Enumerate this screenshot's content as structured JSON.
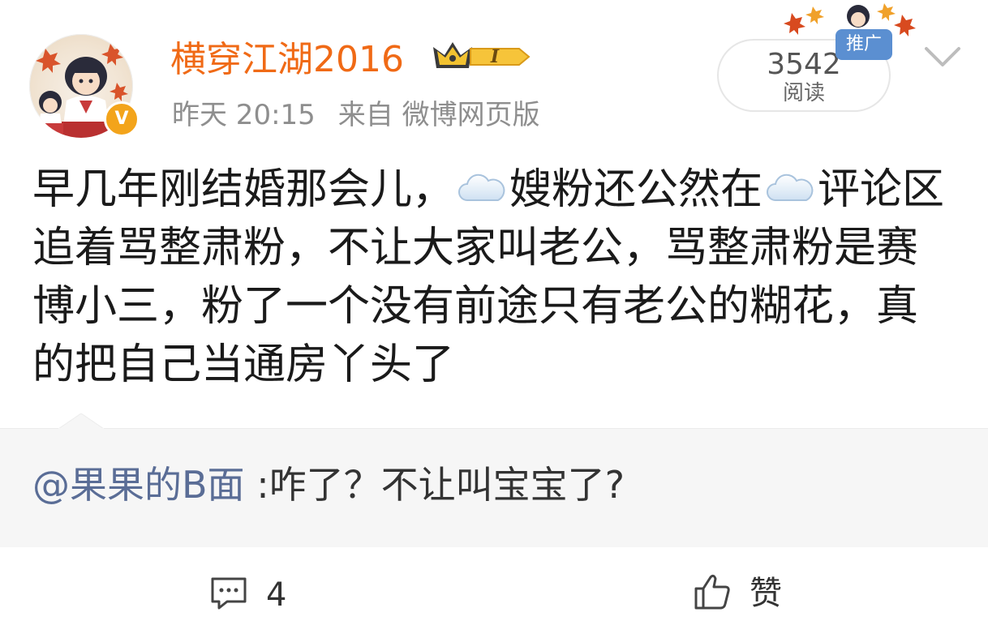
{
  "post": {
    "username": "横穿江湖2016",
    "vip_level": "I",
    "time": "昨天 20:15",
    "source": "来自 微博网页版",
    "promo_label": "推广",
    "read_count": "3542",
    "read_label": "阅读",
    "text_parts": [
      "早几年刚结婚那会儿，",
      "嫂粉还公然在",
      "评论区追着骂整肃粉，不让大家叫老公，骂整肃粉是赛博小三，粉了一个没有前途只有老公的糊花，真的把自己当通房丫头了"
    ],
    "emoji_names": [
      "cloud-emoji",
      "cloud-emoji"
    ]
  },
  "comment": {
    "author": "@果果的B面",
    "text": ":咋了？不让叫宝宝了?"
  },
  "actions": {
    "comment_count": "4",
    "like_label": "赞"
  },
  "colors": {
    "username": "#f06a16",
    "mention": "#5a6d96",
    "promo": "#5b8fd1",
    "verified_badge": "#f3a41b"
  }
}
